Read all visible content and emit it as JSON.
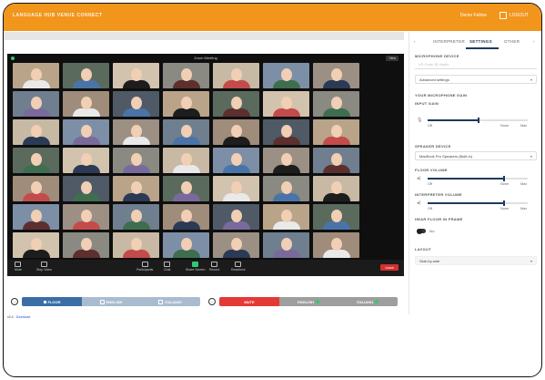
{
  "header": {
    "title": "LANGUAGE HUB VENUE CONNECT",
    "user": "Demo Fellow",
    "logout": "LOGOUT",
    "bg_color": "#f2951b"
  },
  "meeting": {
    "title": "Zoom Meeting",
    "recording": "View"
  },
  "controls": [
    {
      "label": "Mute",
      "icon": "microphone-icon"
    },
    {
      "label": "Stop Video",
      "icon": "video-camera-icon"
    },
    {
      "label": "Participants",
      "icon": "participants-icon"
    },
    {
      "label": "Chat",
      "icon": "chat-icon"
    },
    {
      "label": "Share Screen",
      "icon": "share-screen-icon"
    },
    {
      "label": "Record",
      "icon": "record-icon"
    },
    {
      "label": "Reactions",
      "icon": "reactions-icon"
    }
  ],
  "leave_label": "Leave",
  "panel": {
    "tabs": [
      "INTERPRETER",
      "SETTINGS",
      "OTHER"
    ],
    "active_tab": "SETTINGS",
    "microphone_label": "MICROPHONE DEVICE",
    "microphone_value": "VS Code 3D Audio",
    "advanced_settings": "Advanced settings",
    "input_gain_heading": "YOUR MICROPHONE GAIN",
    "input_gain_label": "INPUT GAIN",
    "input_gain": {
      "min": "Off",
      "mid": "Norm",
      "max": "Max",
      "value": 0.5
    },
    "speaker_label": "SPEAKER DEVICE",
    "speaker_value": "MacBook Pro Speakers (Built-in)",
    "floor_volume_label": "FLOOR VOLUME",
    "floor_volume": {
      "min": "Off",
      "mid": "Norm",
      "max": "Max",
      "value": 0.75
    },
    "interpreter_volume_label": "INTERPRETER VOLUME",
    "interpreter_volume": {
      "min": "Off",
      "mid": "Norm",
      "max": "Max",
      "value": 0.75
    },
    "hear_floor_label": "HEAR FLOOR IN FRAME",
    "hear_floor_value": "No",
    "layout_label": "LAYOUT",
    "layout_value": "Side-by-side"
  },
  "listen_bar": {
    "options": [
      "FLOOR",
      "ENGLISH",
      "ITALIANO"
    ],
    "active": "FLOOR",
    "active_color": "#3a6ea5",
    "inactive_color": "#a9bccf"
  },
  "speak_bar": {
    "options": [
      "MUTE",
      "ENGLISH",
      "ITALIANO"
    ],
    "active": "MUTE",
    "mute_color": "#e53935",
    "inactive_color": "#9e9e9e"
  },
  "footer": {
    "text": "v2.4 · ",
    "link": "Download"
  },
  "grid_tiles": 49
}
